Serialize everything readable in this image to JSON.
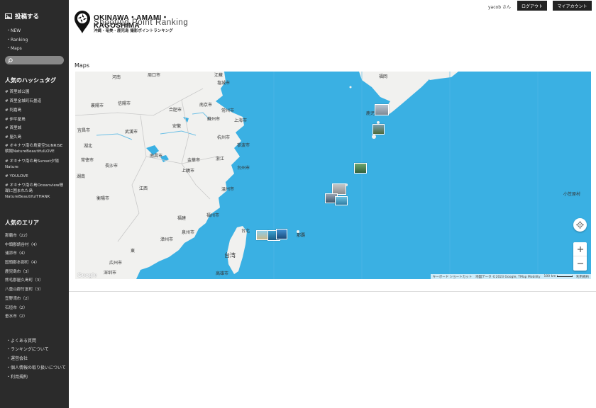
{
  "sidebar": {
    "post_label": "投稿する",
    "nav": [
      {
        "label": "・NEW"
      },
      {
        "label": "・Ranking"
      },
      {
        "label": "・Maps"
      }
    ],
    "search": {
      "placeholder": ""
    },
    "hashtags_title": "人気のハッシュタグ",
    "hashtags": [
      {
        "label": "# 首里城公園"
      },
      {
        "label": "# 首里金城町石畳道"
      },
      {
        "label": "# 阿嘉島"
      },
      {
        "label": "# 伊平屋島"
      },
      {
        "label": "# 首里城"
      },
      {
        "label": "# 屋久島"
      },
      {
        "label": "# オキナワ南の島夏空SUNRISE朝陽NatureBeautifulLOVE"
      },
      {
        "label": "# オキナワ南の島Sunset夕陽Nature"
      },
      {
        "label": "# YOULOVE"
      },
      {
        "label": "# オキナワ南の島Oceanview珊瑚に囲まれた島NatureBeautifulTHANK"
      }
    ],
    "areas_title": "人気のエリア",
    "areas": [
      {
        "label": "那覇市（22）"
      },
      {
        "label": "中頭郡読谷村（4）"
      },
      {
        "label": "浦添市（4）"
      },
      {
        "label": "国頭郡本部町（4）"
      },
      {
        "label": "鹿児島市（3）"
      },
      {
        "label": "熊毛郡屋久島町（3）"
      },
      {
        "label": "八重山郡竹富町（3）"
      },
      {
        "label": "宜野湾市（2）"
      },
      {
        "label": "石垣市（2）"
      },
      {
        "label": "垂水市（2）"
      }
    ],
    "footer": [
      {
        "label": "・よくある質問"
      },
      {
        "label": "・ランキングについて"
      },
      {
        "label": "・運営会社"
      },
      {
        "label": "・個人情報の取り扱いについて"
      },
      {
        "label": "・利用規約"
      }
    ]
  },
  "header": {
    "user_label": "yacob さん",
    "logout_label": "ログアウト",
    "account_label": "マイアカウント",
    "logo_line1": "OKINAWA・AMAMI・KAGOSHIMA",
    "logo_line2": "Shooting Point Ranking",
    "logo_line3": "沖縄・奄美・鹿児島 撮影ポイントランキング"
  },
  "main": {
    "maps_title": "Maps"
  },
  "map": {
    "cities": [
      {
        "label": "河南"
      },
      {
        "label": "周口市"
      },
      {
        "label": "江蘇"
      },
      {
        "label": "塩城市"
      },
      {
        "label": "襄陽市"
      },
      {
        "label": "信陽市"
      },
      {
        "label": "合肥市"
      },
      {
        "label": "南京市"
      },
      {
        "label": "常州市"
      },
      {
        "label": "蘇州市"
      },
      {
        "label": "上海市"
      },
      {
        "label": "宜昌市"
      },
      {
        "label": "武漢市"
      },
      {
        "label": "安徽"
      },
      {
        "label": "杭州市"
      },
      {
        "label": "湖北"
      },
      {
        "label": "寧波市"
      },
      {
        "label": "常徳市"
      },
      {
        "label": "長沙市"
      },
      {
        "label": "南昌市"
      },
      {
        "label": "金華市"
      },
      {
        "label": "浙江"
      },
      {
        "label": "湖南"
      },
      {
        "label": "上饒市"
      },
      {
        "label": "台州市"
      },
      {
        "label": "江西"
      },
      {
        "label": "衡陽市"
      },
      {
        "label": "温州市"
      },
      {
        "label": "福建"
      },
      {
        "label": "漳州市"
      },
      {
        "label": "泉州市"
      },
      {
        "label": "東"
      },
      {
        "label": "広州市"
      },
      {
        "label": "深圳市"
      },
      {
        "label": "福州市"
      },
      {
        "label": "台北"
      },
      {
        "label": "台湾"
      },
      {
        "label": "高雄市"
      },
      {
        "label": "福岡"
      },
      {
        "label": "鹿児島市"
      },
      {
        "label": "那覇"
      },
      {
        "label": "小笠原村"
      }
    ],
    "attribution": {
      "shortcuts": "キーボード ショートカット",
      "data": "地図データ ©2023 Google, TMap Mobility",
      "scale": "100 km",
      "terms": "利用規約"
    },
    "google_label": "Google",
    "icons": {
      "locate": "locate-icon",
      "zoom_in": "plus-icon",
      "zoom_out": "minus-icon"
    }
  },
  "colors": {
    "sidebar_bg": "#2b2b2b",
    "sea": "#3ab0e3",
    "land": "#f1f1ef",
    "button_bg": "#222222"
  }
}
